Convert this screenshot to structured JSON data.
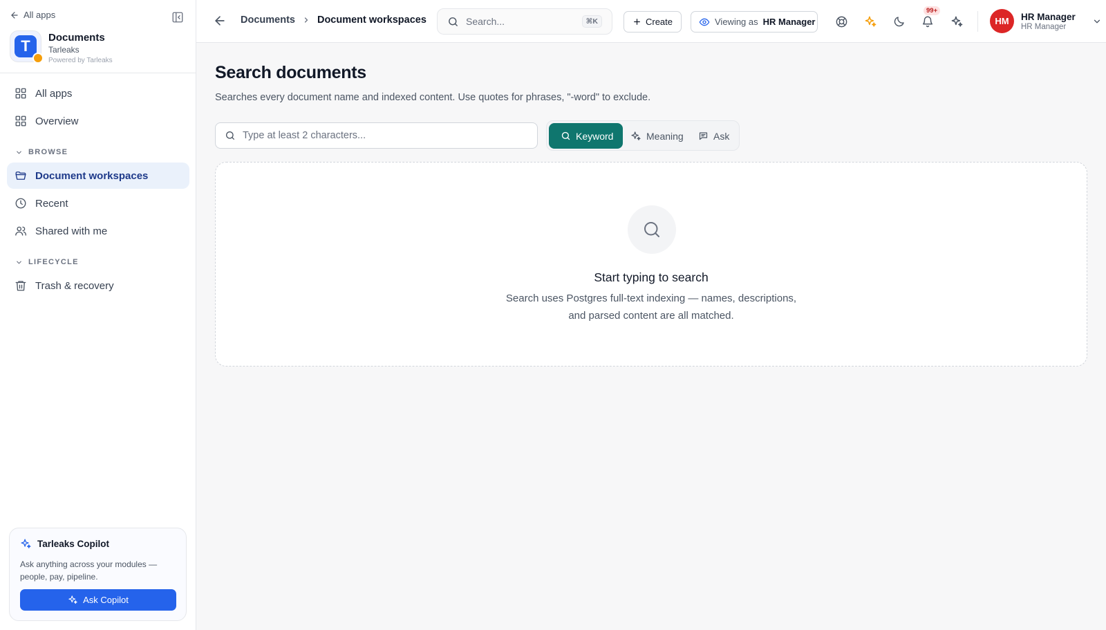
{
  "sidebar": {
    "back_label": "All apps",
    "app_name": "Documents",
    "org_name": "Tarleaks",
    "logo_letter": "T",
    "powered_by": "Powered by Tarleaks",
    "nav_top": [
      {
        "label": "All apps",
        "icon": "grid-icon"
      },
      {
        "label": "Overview",
        "icon": "grid-icon"
      }
    ],
    "browse_label": "BROWSE",
    "browse_items": [
      {
        "label": "Document workspaces",
        "icon": "folder-icon",
        "active": true
      },
      {
        "label": "Recent",
        "icon": "clock-icon",
        "active": false
      },
      {
        "label": "Shared with me",
        "icon": "users-icon",
        "active": false
      }
    ],
    "lifecycle_label": "LIFECYCLE",
    "lifecycle_items": [
      {
        "label": "Trash & recovery",
        "icon": "trash-icon"
      }
    ],
    "copilot": {
      "title": "Tarleaks Copilot",
      "description": "Ask anything across your modules — people, pay, pipeline.",
      "button_label": "Ask Copilot"
    }
  },
  "header": {
    "breadcrumb": [
      "Documents",
      "Document workspaces"
    ],
    "search_placeholder": "Search...",
    "search_shortcut": "⌘K",
    "create_label": "Create",
    "viewing_prefix": "Viewing as",
    "viewing_role": "HR Manager",
    "notification_count": "99+",
    "user": {
      "initials": "HM",
      "name": "HR Manager",
      "role": "HR Manager"
    }
  },
  "main": {
    "title": "Search documents",
    "subtitle": "Searches every document name and indexed content. Use quotes for phrases, \"-word\" to exclude.",
    "search_placeholder": "Type at least 2 characters...",
    "modes": [
      {
        "label": "Keyword",
        "active": true
      },
      {
        "label": "Meaning",
        "active": false
      },
      {
        "label": "Ask",
        "active": false
      }
    ],
    "empty_state": {
      "title": "Start typing to search",
      "description_line1": "Search uses Postgres full-text indexing — names, descriptions,",
      "description_line2": "and parsed content are all matched."
    }
  },
  "colors": {
    "primary_blue": "#2563eb",
    "teal_active": "#0f766e",
    "avatar_red": "#dc2626",
    "nav_active_bg": "#eaf1fb"
  }
}
